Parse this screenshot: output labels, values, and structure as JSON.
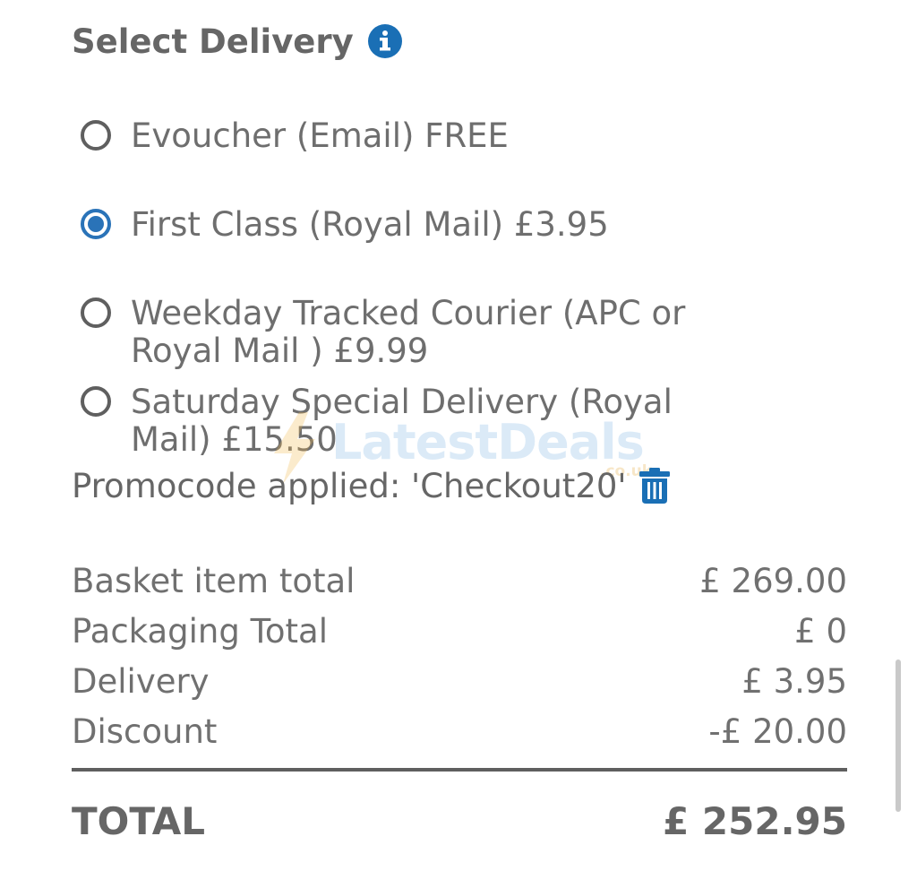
{
  "delivery": {
    "heading": "Select Delivery",
    "options": [
      {
        "label": "Evoucher (Email) FREE",
        "selected": false
      },
      {
        "label": "First Class (Royal Mail) £3.95",
        "selected": true
      },
      {
        "label": "Weekday Tracked Courier (APC or Royal Mail ) £9.99",
        "selected": false
      },
      {
        "label": "Saturday Special Delivery (Royal Mail) £15.50",
        "selected": false
      }
    ]
  },
  "promo": {
    "text": "Promocode applied: 'Checkout20'"
  },
  "watermark": {
    "text": "LatestDeals",
    "sub": ".co.uk"
  },
  "summary": {
    "rows": [
      {
        "label": "Basket item total",
        "value": "£ 269.00"
      },
      {
        "label": "Packaging Total",
        "value": "£ 0"
      },
      {
        "label": "Delivery",
        "value": "£ 3.95"
      },
      {
        "label": "Discount",
        "value": "-£ 20.00"
      }
    ],
    "total_label": "TOTAL",
    "total_value": "£ 252.95"
  },
  "colors": {
    "accent": "#2a73b8",
    "text": "#666666",
    "icon_blue": "#1a6fb5"
  },
  "icons": {
    "info": "info-icon",
    "trash": "trash-icon"
  }
}
